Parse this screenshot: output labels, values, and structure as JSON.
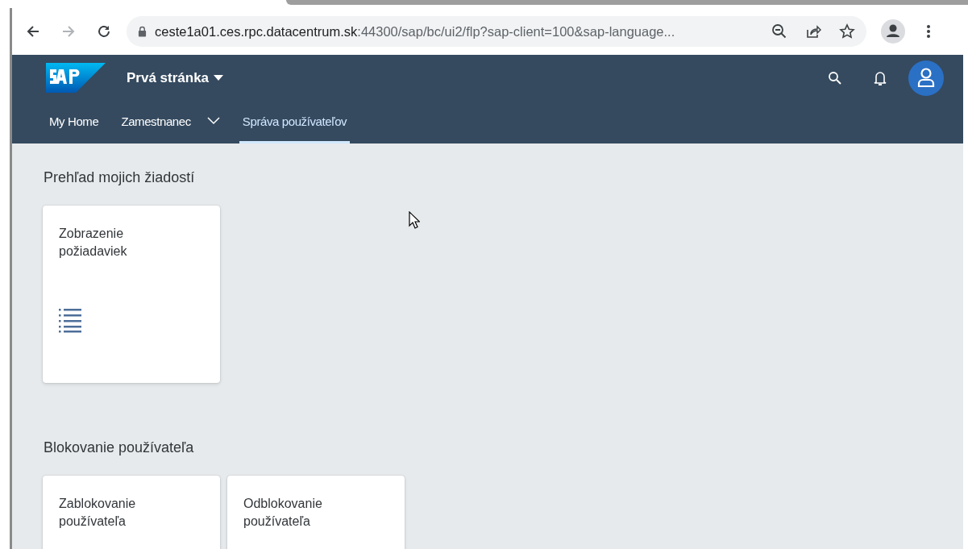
{
  "browser": {
    "address_host": "ceste1a01.ces.rpc.datacentrum.sk",
    "address_rest": ":44300/sap/bc/ui2/flp?sap-client=100&sap-language..."
  },
  "shell": {
    "title": "Prvá stránka",
    "nav": [
      {
        "label": "My Home",
        "selected": false,
        "kind": "link"
      },
      {
        "label": "Zamestnanec",
        "selected": false,
        "kind": "menu"
      },
      {
        "label": "Správa používateľov",
        "selected": true,
        "kind": "link"
      }
    ]
  },
  "groups": [
    {
      "title": "Prehľad mojich žiadostí",
      "tiles": [
        {
          "title": "Zobrazenie požiadaviek",
          "kind": "list"
        }
      ]
    },
    {
      "title": "Blokovanie používateľa",
      "tiles": [
        {
          "title": "Zablokovanie používateľa",
          "kind": "text"
        },
        {
          "title": "Odblokovanie používateľa",
          "kind": "text"
        }
      ]
    }
  ]
}
